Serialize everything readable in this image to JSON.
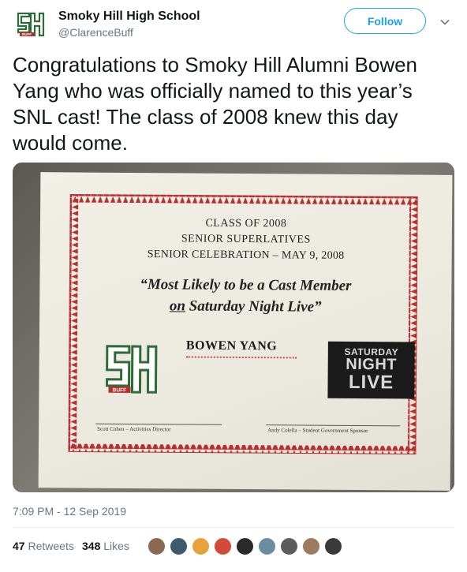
{
  "author": {
    "name": "Smoky Hill High School",
    "handle": "@ClarenceBuff",
    "avatar_icon": "school-logo-icon"
  },
  "header": {
    "follow_label": "Follow",
    "menu_icon": "chevron-down-icon"
  },
  "tweet": {
    "text": "Congratulations to Smoky Hill Alumni Bowen Yang who was officially named to this year’s SNL cast!  The class of 2008 knew this day would come."
  },
  "photo": {
    "class_line": "CLASS OF 2008",
    "superlatives_line": "SENIOR SUPERLATIVES",
    "celebration_line": "SENIOR CELEBRATION – MAY 9, 2008",
    "quote_line1": "“Most Likely to be a Cast Member",
    "quote_line2_on": "on",
    "quote_line2_rest": " Saturday Night Live”",
    "name": "BOWEN YANG",
    "snl_word1": "SATURDAY",
    "snl_word2": "NIGHT",
    "snl_word3": "LIVE",
    "sig_left": "Scott Cohen – Activities Director",
    "sig_right": "Andy Colella – Student Government Sponsor",
    "logo_word": "BUFF",
    "colors": {
      "border_red": "#b5302f",
      "logo_green": "#2f6b3a"
    }
  },
  "meta": {
    "timestamp": "7:09 PM - 12 Sep 2019",
    "retweets_count": "47",
    "retweets_label": "Retweets",
    "likes_count": "348",
    "likes_label": "Likes"
  },
  "colors": {
    "accent": "#1da1f2",
    "text_primary": "#14171a",
    "text_secondary": "#657786"
  }
}
